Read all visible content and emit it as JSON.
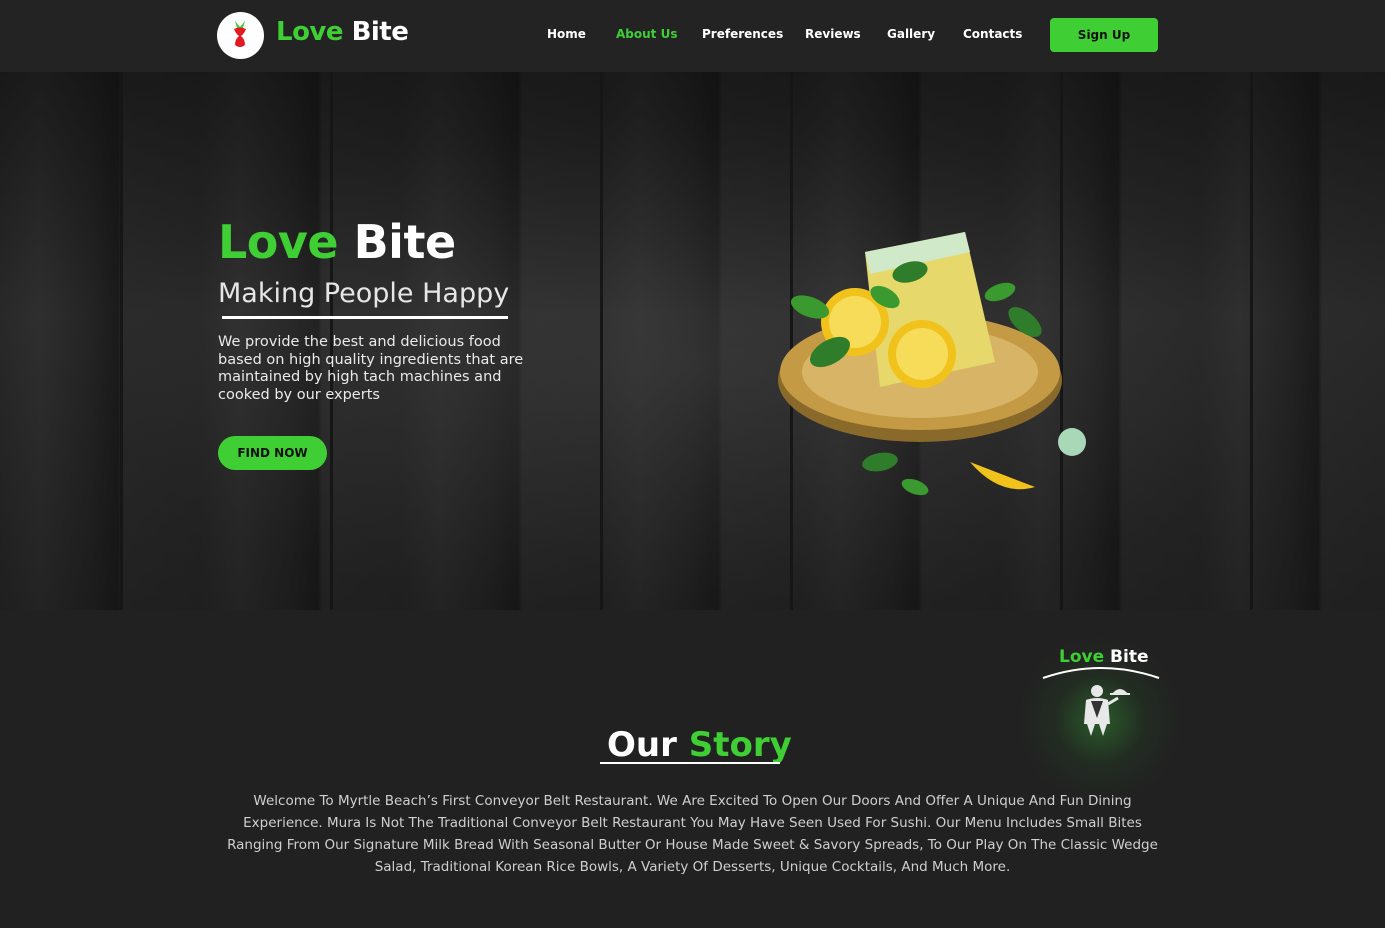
{
  "brand": {
    "name_part1": "Love",
    "name_part2": "Bite",
    "accent_color": "#3fcf35"
  },
  "nav": {
    "items": [
      {
        "label": "Home",
        "active": false
      },
      {
        "label": "About Us",
        "active": true
      },
      {
        "label": "Preferences",
        "active": false
      },
      {
        "label": "Reviews",
        "active": false
      },
      {
        "label": "Gallery",
        "active": false
      },
      {
        "label": "Contacts",
        "active": false
      }
    ],
    "signup_label": "Sign Up"
  },
  "hero": {
    "title_part1": "Love",
    "title_part2": "Bite",
    "subtitle": "Making People Happy",
    "description": "We provide the best and delicious food based on high quality ingredients that are maintained by high tach machines and cooked by our experts",
    "cta_label": "FIND NOW",
    "image_icon": "lemon-cake-image"
  },
  "story": {
    "badge_part1": "Love",
    "badge_part2": "Bite",
    "badge_icon": "waiter-icon",
    "title_part1": "Our",
    "title_part2": "Story",
    "text": "Welcome To Myrtle Beach’s First Conveyor Belt Restaurant. We Are Excited To Open Our Doors And Offer A Unique And Fun Dining Experience. Mura Is Not The Traditional Conveyor Belt Restaurant You May Have Seen Used For Sushi. Our Menu Includes Small Bites Ranging From Our Signature Milk Bread With Seasonal Butter Or House Made Sweet & Savory Spreads, To Our Play On The Classic Wedge Salad, Traditional Korean Rice Bowls, A Variety Of Desserts, Unique Cocktails, And Much More."
  }
}
